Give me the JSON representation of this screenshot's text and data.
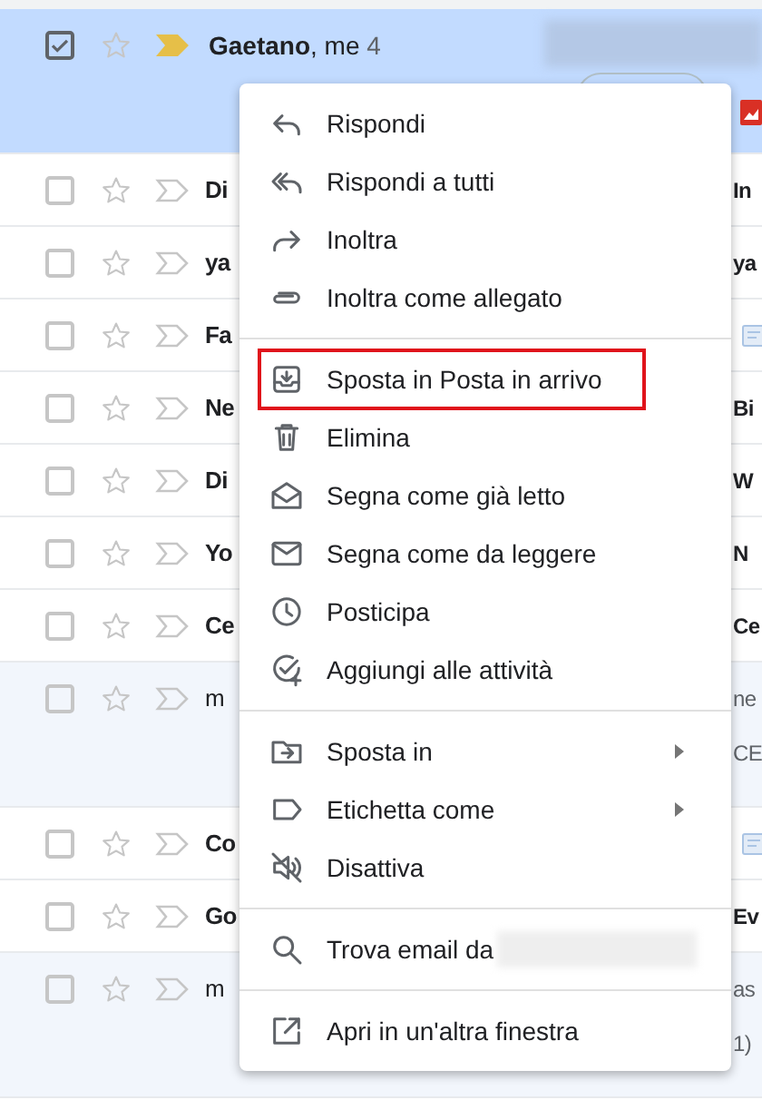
{
  "selected_thread": {
    "sender": "Gaetano",
    "others": ", me",
    "count": "4",
    "selected": true,
    "starred": false,
    "important": true
  },
  "threads": [
    {
      "sender": "Di",
      "right": [
        "In"
      ],
      "read": false,
      "kind": "text"
    },
    {
      "sender": "ya",
      "right": [
        "ya"
      ],
      "read": false,
      "kind": "text"
    },
    {
      "sender": "Fa",
      "read": false,
      "kind": "attachment"
    },
    {
      "sender": "Ne",
      "right": [
        "Bi"
      ],
      "read": false,
      "kind": "text"
    },
    {
      "sender": "Di",
      "right": [
        "W"
      ],
      "read": false,
      "kind": "text"
    },
    {
      "sender": "Yo",
      "right": [
        "N"
      ],
      "read": false,
      "kind": "text"
    },
    {
      "sender": "Ce",
      "right": [
        "Ce"
      ],
      "read": false,
      "kind": "text"
    },
    {
      "sender": "m",
      "right": [
        "ne",
        "CE"
      ],
      "read": true,
      "kind": "text"
    },
    {
      "sender": "Co",
      "read": false,
      "kind": "attachment"
    },
    {
      "sender": "Go",
      "right": [
        "Ev"
      ],
      "read": false,
      "kind": "text"
    },
    {
      "sender": "m",
      "right": [
        "as",
        "1)"
      ],
      "read": true,
      "kind": "text"
    }
  ],
  "menu": {
    "groups": [
      {
        "items": [
          {
            "label": "Rispondi",
            "kind": "reply"
          },
          {
            "label": "Rispondi a tutti",
            "kind": "reply-all"
          },
          {
            "label": "Inoltra",
            "kind": "forward"
          },
          {
            "label": "Inoltra come allegato",
            "kind": "attach"
          }
        ]
      },
      {
        "items": [
          {
            "label": "Sposta in Posta in arrivo",
            "kind": "inbox",
            "highlighted": true
          },
          {
            "label": "Elimina",
            "kind": "delete"
          },
          {
            "label": "Segna come già letto",
            "kind": "read"
          },
          {
            "label": "Segna come da leggere",
            "kind": "unread"
          },
          {
            "label": "Posticipa",
            "kind": "snooze"
          },
          {
            "label": "Aggiungi alle attività",
            "kind": "task"
          }
        ]
      },
      {
        "items": [
          {
            "label": "Sposta in",
            "kind": "move",
            "submenu": true
          },
          {
            "label": "Etichetta come",
            "kind": "label",
            "submenu": true
          },
          {
            "label": "Disattiva",
            "kind": "mute"
          }
        ]
      },
      {
        "items": [
          {
            "label": "Trova email da",
            "kind": "search",
            "blurred_suffix": true
          }
        ]
      },
      {
        "items": [
          {
            "label": "Apri in un'altra finestra",
            "kind": "open"
          }
        ]
      }
    ]
  }
}
